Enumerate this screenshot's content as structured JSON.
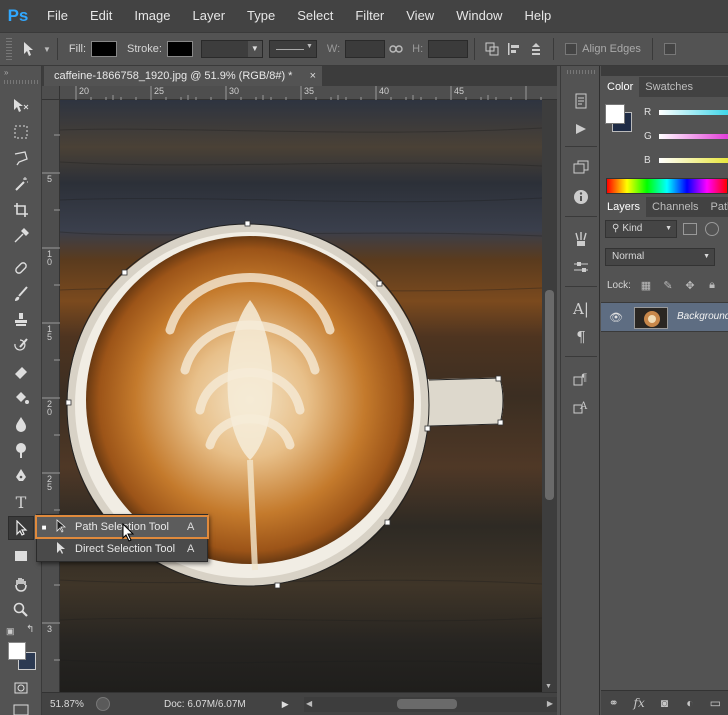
{
  "app": {
    "logo": "Ps"
  },
  "menu": [
    "File",
    "Edit",
    "Image",
    "Layer",
    "Type",
    "Select",
    "Filter",
    "View",
    "Window",
    "Help"
  ],
  "options": {
    "fill_label": "Fill:",
    "stroke_label": "Stroke:",
    "w_label": "W:",
    "h_label": "H:",
    "align_edges_label": "Align Edges"
  },
  "document": {
    "tab_title": "caffeine-1866758_1920.jpg @ 51.9% (RGB/8#) *",
    "close_glyph": "×"
  },
  "rulers": {
    "horizontal_labels": [
      "20",
      "25",
      "30",
      "35",
      "40",
      "45"
    ],
    "vertical_labels": [
      "5",
      "1 0",
      "1 5",
      "2 0",
      "2 5",
      "3"
    ]
  },
  "status": {
    "zoom": "51.87%",
    "doc": "Doc: 6.07M/6.07M"
  },
  "flyout": {
    "items": [
      {
        "label": "Path Selection Tool",
        "shortcut": "A",
        "selected": true
      },
      {
        "label": "Direct Selection Tool",
        "shortcut": "A",
        "selected": false
      }
    ]
  },
  "color_panel": {
    "tabs": [
      "Color",
      "Swatches"
    ],
    "sliders": [
      "R",
      "G",
      "B"
    ],
    "colors": {
      "r": "#3cd5e8",
      "g": "#e23ad8",
      "b": "#e8e63a"
    }
  },
  "layers_panel": {
    "tabs": [
      "Layers",
      "Channels",
      "Paths"
    ],
    "kind_label": "Kind",
    "blend_mode": "Normal",
    "lock_label": "Lock:",
    "layer_name": "Background"
  },
  "colors": {
    "accent": "#e08a3c",
    "layer_selected": "#5e6d82"
  }
}
